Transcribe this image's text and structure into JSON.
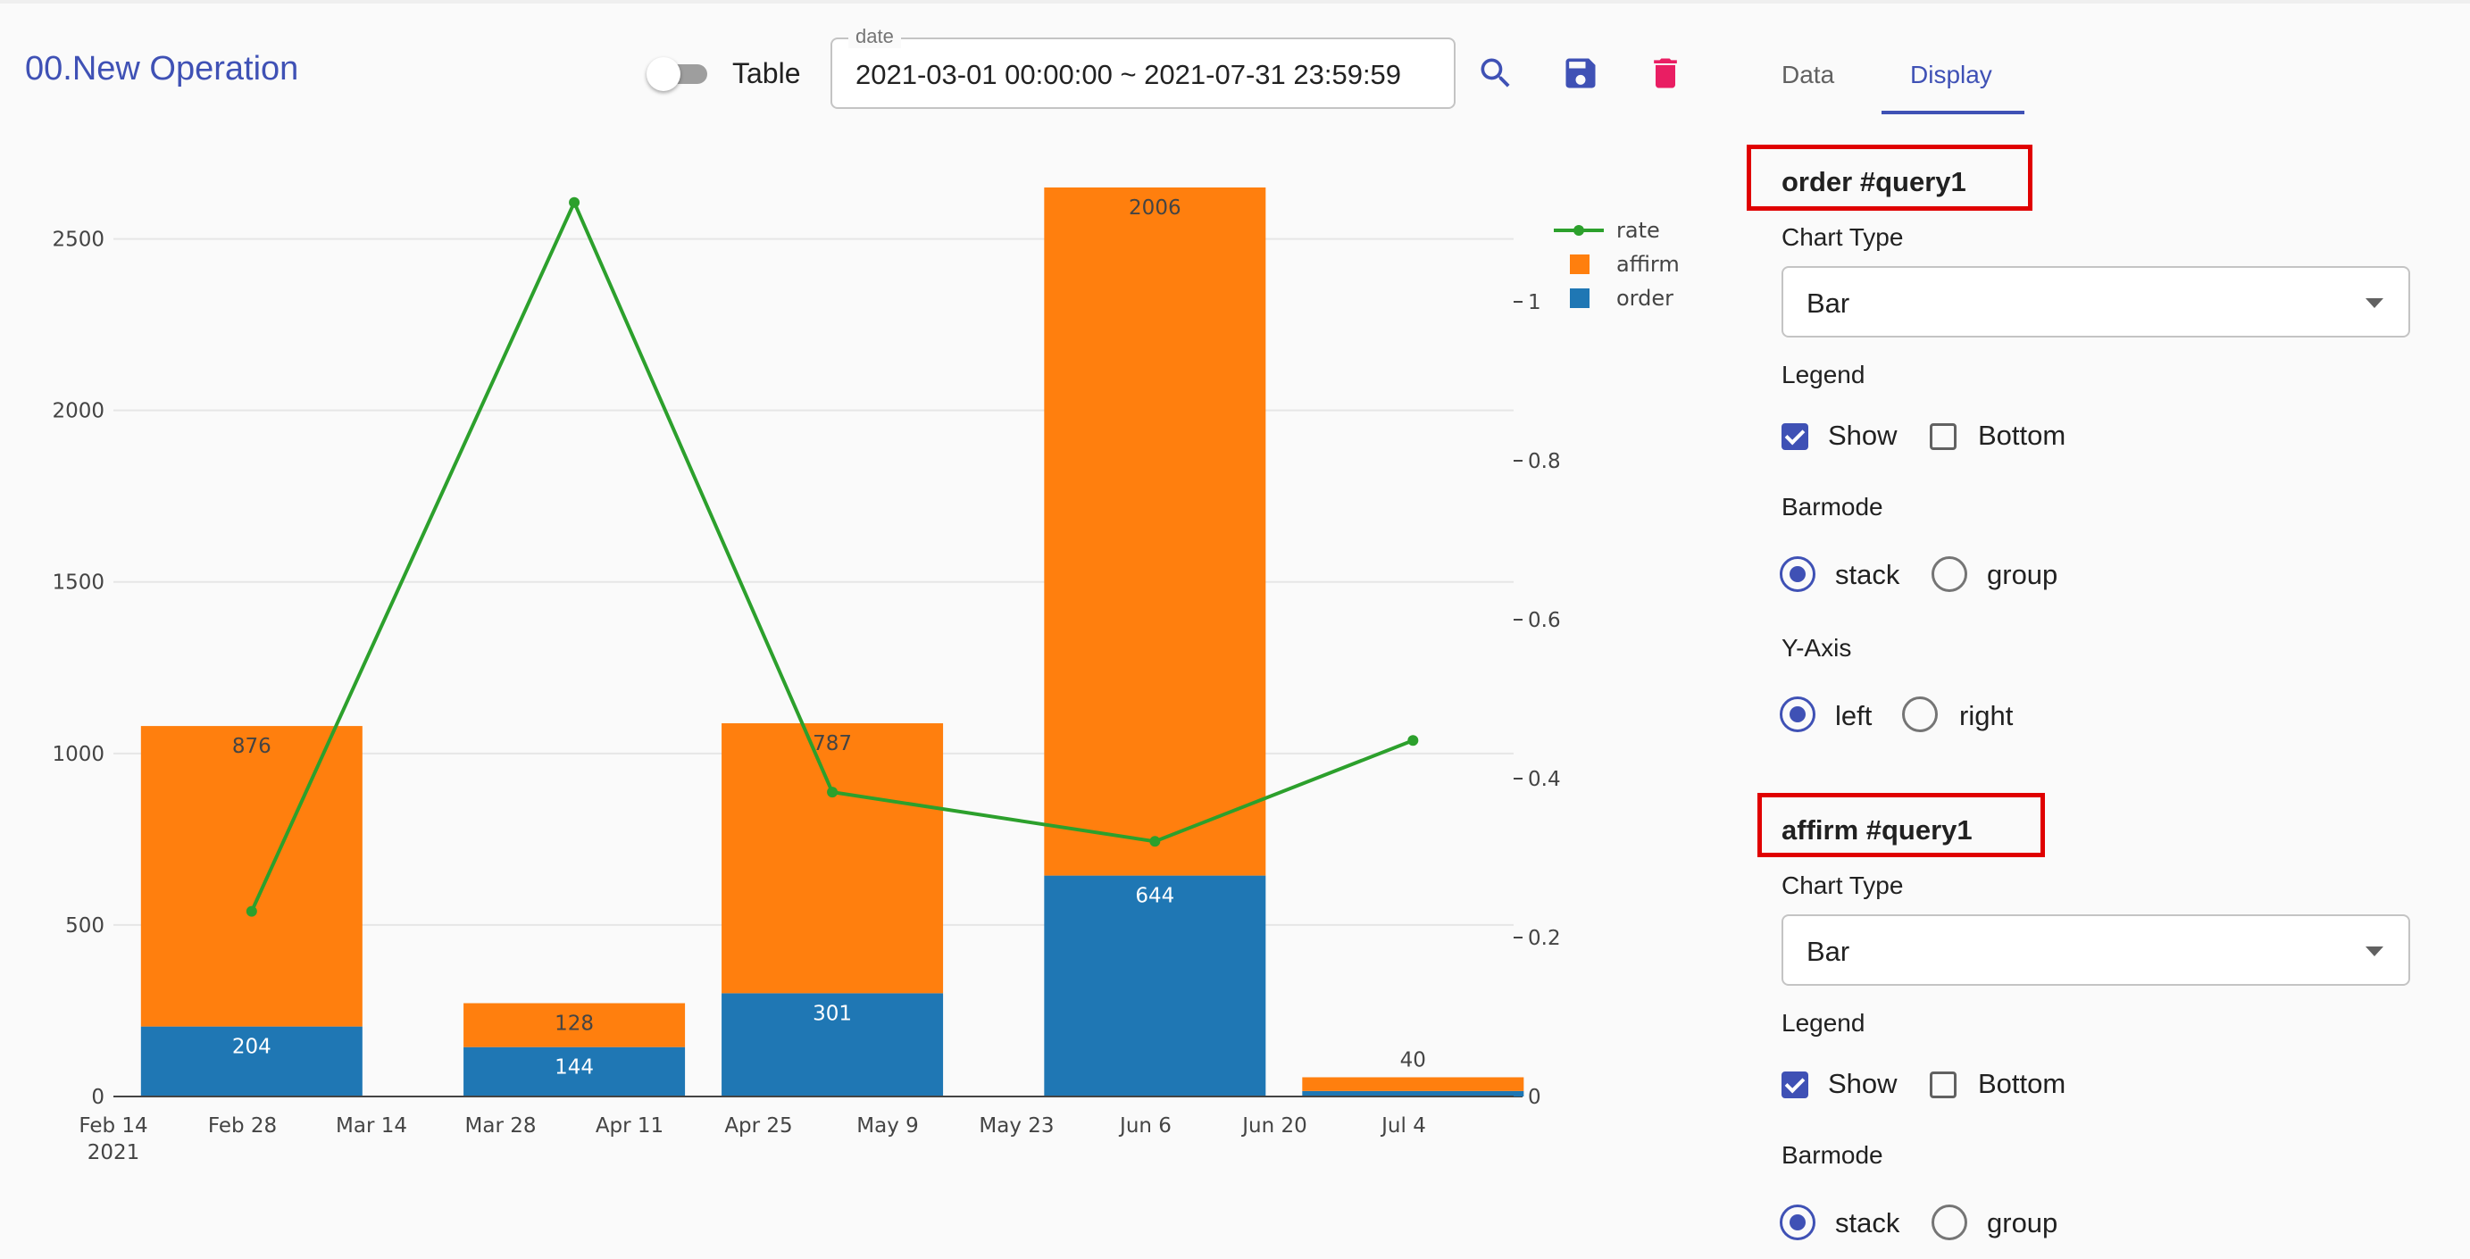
{
  "header": {
    "title": "00.New Operation",
    "table_toggle_label": "Table",
    "date_legend": "date",
    "date_value": "2021-03-01 00:00:00 ~ 2021-07-31 23:59:59"
  },
  "tabs": [
    {
      "label": "Data",
      "active": false
    },
    {
      "label": "Display",
      "active": true
    }
  ],
  "icons": [
    "search-icon",
    "save-icon",
    "delete-icon"
  ],
  "colors": {
    "accent": "#3f51b5",
    "delete": "#e91e63",
    "order": "#1f77b4",
    "affirm": "#ff7f0e",
    "rate": "#2ca02c",
    "highlight": "#e00000"
  },
  "chart_data": {
    "type": "bar",
    "barmode": "stack",
    "x": [
      "2021-03-01",
      "2021-04-05",
      "2021-05-03",
      "2021-06-07",
      "2021-07-05"
    ],
    "series": [
      {
        "name": "order",
        "type": "bar",
        "axis": "left",
        "values": [
          204,
          144,
          301,
          644,
          16
        ],
        "labels": [
          "204",
          "144",
          "301",
          "644",
          ""
        ]
      },
      {
        "name": "affirm",
        "type": "bar",
        "axis": "left",
        "values": [
          876,
          128,
          787,
          2006,
          40
        ],
        "labels": [
          "876",
          "128",
          "787",
          "2006",
          "40"
        ]
      },
      {
        "name": "rate",
        "type": "line",
        "axis": "right",
        "values": [
          0.233,
          1.125,
          0.383,
          0.321,
          0.448
        ]
      }
    ],
    "x_ticks": [
      "Feb 14",
      "Feb 28",
      "Mar 14",
      "Mar 28",
      "Apr 11",
      "Apr 25",
      "May 9",
      "May 23",
      "Jun 6",
      "Jun 20",
      "Jul 4"
    ],
    "x_year_label": "2021",
    "y_left": {
      "ticks": [
        "0",
        "500",
        "1000",
        "1500",
        "2000",
        "2500"
      ],
      "range": [
        0,
        2780
      ]
    },
    "y_right": {
      "ticks": [
        "0",
        "0.2",
        "0.4",
        "0.6",
        "0.8",
        "1"
      ],
      "range": [
        0,
        1.2
      ]
    },
    "legend": [
      "rate",
      "affirm",
      "order"
    ],
    "legend_position": "top-right",
    "grid": true
  },
  "panel": {
    "sections": [
      {
        "title": "order #query1",
        "chart_type_label": "Chart Type",
        "chart_type_value": "Bar",
        "legend_label": "Legend",
        "legend_show": "Show",
        "legend_bottom": "Bottom",
        "barmode_label": "Barmode",
        "barmode_stack": "stack",
        "barmode_group": "group",
        "yaxis_label": "Y-Axis",
        "yaxis_left": "left",
        "yaxis_right": "right"
      },
      {
        "title": "affirm #query1",
        "chart_type_label": "Chart Type",
        "chart_type_value": "Bar",
        "legend_label": "Legend",
        "legend_show": "Show",
        "legend_bottom": "Bottom",
        "barmode_label": "Barmode",
        "barmode_stack": "stack",
        "barmode_group": "group"
      }
    ]
  }
}
